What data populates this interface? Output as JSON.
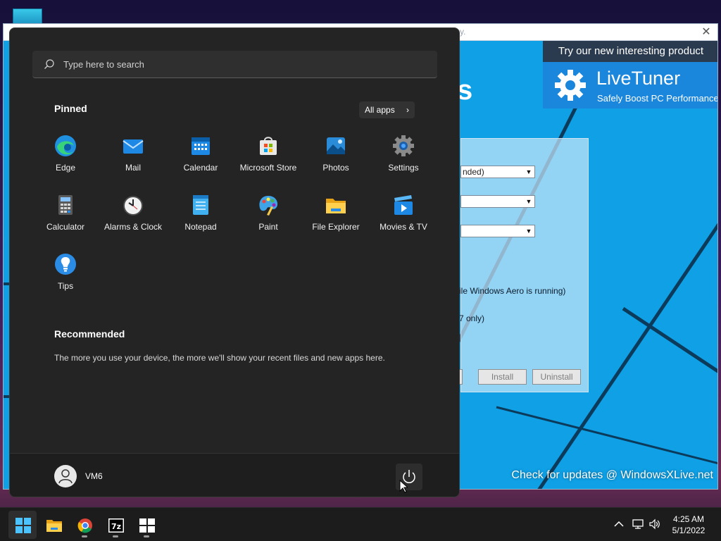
{
  "desktop": {
    "shortcut_icon": "app-shortcut-icon"
  },
  "background_window": {
    "title_fragment": "y.",
    "big_letter": "s",
    "promo": {
      "banner": "Try our new interesting product",
      "product_name": "LiveTuner",
      "tagline": "Safely Boost PC Performance",
      "icon": "gear-icon"
    },
    "combos": [
      "nded)",
      "",
      ""
    ],
    "options": [
      "ile Windows Aero is running)",
      "7 only)"
    ],
    "buttons": {
      "partial": "e",
      "install": "Install",
      "uninstall": "Uninstall"
    },
    "footer_text": "Check for updates @ WindowsXLive.net"
  },
  "start_menu": {
    "search_placeholder": "Type here to search",
    "pinned_title": "Pinned",
    "all_apps_label": "All apps",
    "pinned": [
      {
        "label": "Edge",
        "icon": "edge-icon"
      },
      {
        "label": "Mail",
        "icon": "mail-icon"
      },
      {
        "label": "Calendar",
        "icon": "calendar-icon"
      },
      {
        "label": "Microsoft Store",
        "icon": "store-icon"
      },
      {
        "label": "Photos",
        "icon": "photos-icon"
      },
      {
        "label": "Settings",
        "icon": "settings-icon"
      },
      {
        "label": "Calculator",
        "icon": "calculator-icon"
      },
      {
        "label": "Alarms & Clock",
        "icon": "clock-icon"
      },
      {
        "label": "Notepad",
        "icon": "notepad-icon"
      },
      {
        "label": "Paint",
        "icon": "paint-icon"
      },
      {
        "label": "File Explorer",
        "icon": "folder-icon"
      },
      {
        "label": "Movies & TV",
        "icon": "movies-icon"
      },
      {
        "label": "Tips",
        "icon": "tips-icon"
      }
    ],
    "recommended_title": "Recommended",
    "recommended_text": "The more you use your device, the more we'll show your recent files and new apps here.",
    "user": "VM6"
  },
  "taskbar": {
    "apps": [
      {
        "name": "Start",
        "icon": "windows-start-icon"
      },
      {
        "name": "File Explorer",
        "icon": "folder-icon"
      },
      {
        "name": "Chrome",
        "icon": "chrome-icon"
      },
      {
        "name": "7-Zip",
        "icon": "7zip-icon"
      },
      {
        "name": "Windows",
        "icon": "windows-logo-icon"
      }
    ],
    "time": "4:25 AM",
    "date": "5/1/2022"
  },
  "colors": {
    "accent": "#0fa0e6",
    "start_bg": "#242424",
    "taskbar_bg": "#1c1c1c"
  }
}
